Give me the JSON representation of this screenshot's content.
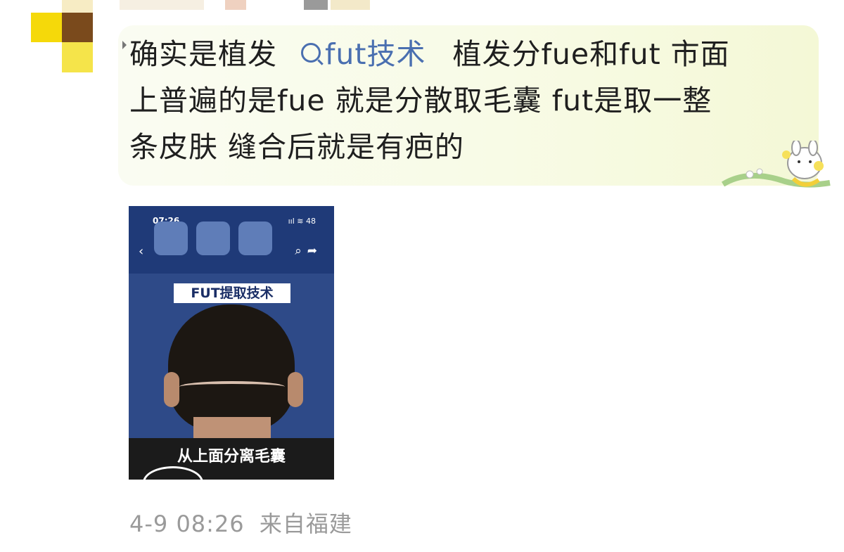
{
  "post": {
    "text_line1_before": "确实是植发",
    "topic_link": "fut技术",
    "text_line1_after": "植发分fue和fut 市面",
    "text_line2": "上普遍的是fue 就是分散取毛囊 fut是取一整",
    "text_line3": "条皮肤 缝合后就是有疤的"
  },
  "video": {
    "status_time": "07:26",
    "status_icons": "ııl ≋ 48",
    "title_overlay": "FUT提取技术",
    "caption": "从上面分离毛囊"
  },
  "meta": {
    "timestamp": "4-9 08:26",
    "location": "来自福建"
  },
  "colors": {
    "link": "#4a6fb0",
    "bubble": "#f8fbe6",
    "meta_text": "#9a9a9a",
    "avatar_yellow": "#f5d90a",
    "avatar_brown": "#7a4a1c"
  }
}
